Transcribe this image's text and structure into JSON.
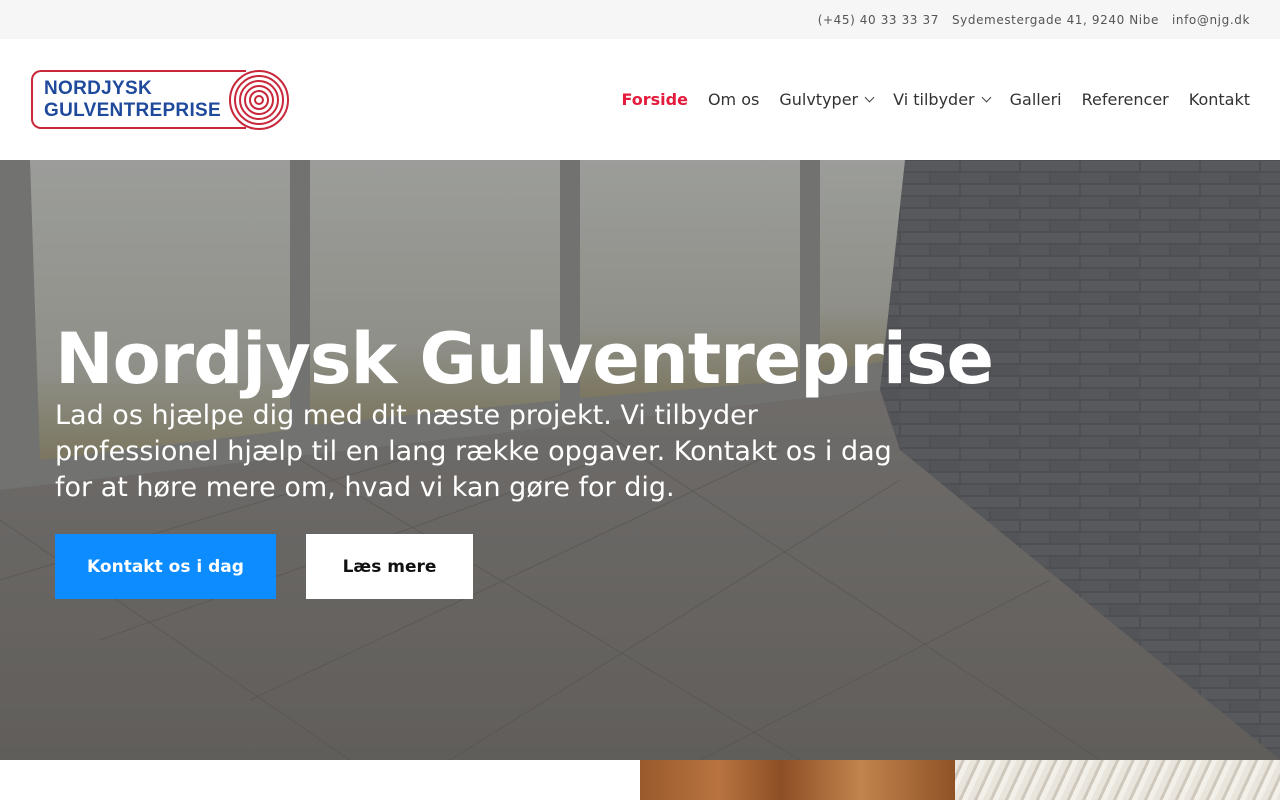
{
  "topbar": {
    "phone": "(+45) 40 33 33 37",
    "address": "Sydemestergade 41, 9240 Nibe",
    "email": "info@njg.dk"
  },
  "logo": {
    "line1": "NORDJYSK",
    "line2": "GULVENTREPRISE"
  },
  "nav": {
    "items": [
      {
        "label": "Forside",
        "active": true
      },
      {
        "label": "Om os"
      },
      {
        "label": "Gulvtyper",
        "dropdown": true
      },
      {
        "label": "Vi tilbyder",
        "dropdown": true
      },
      {
        "label": "Galleri"
      },
      {
        "label": "Referencer"
      },
      {
        "label": "Kontakt"
      }
    ]
  },
  "hero": {
    "title": "Nordjysk Gulventreprise",
    "text": "Lad os hjælpe dig med dit næste projekt. Vi tilbyder professionel hjælp til en lang række opgaver. Kontakt os i dag for at høre mere om, hvad vi kan gøre for dig.",
    "primary_button": "Kontakt os i dag",
    "secondary_button": "Læs mere"
  },
  "colors": {
    "accent_red": "#e31c3d",
    "logo_blue": "#1f4a9c",
    "button_blue": "#0d8cff"
  }
}
